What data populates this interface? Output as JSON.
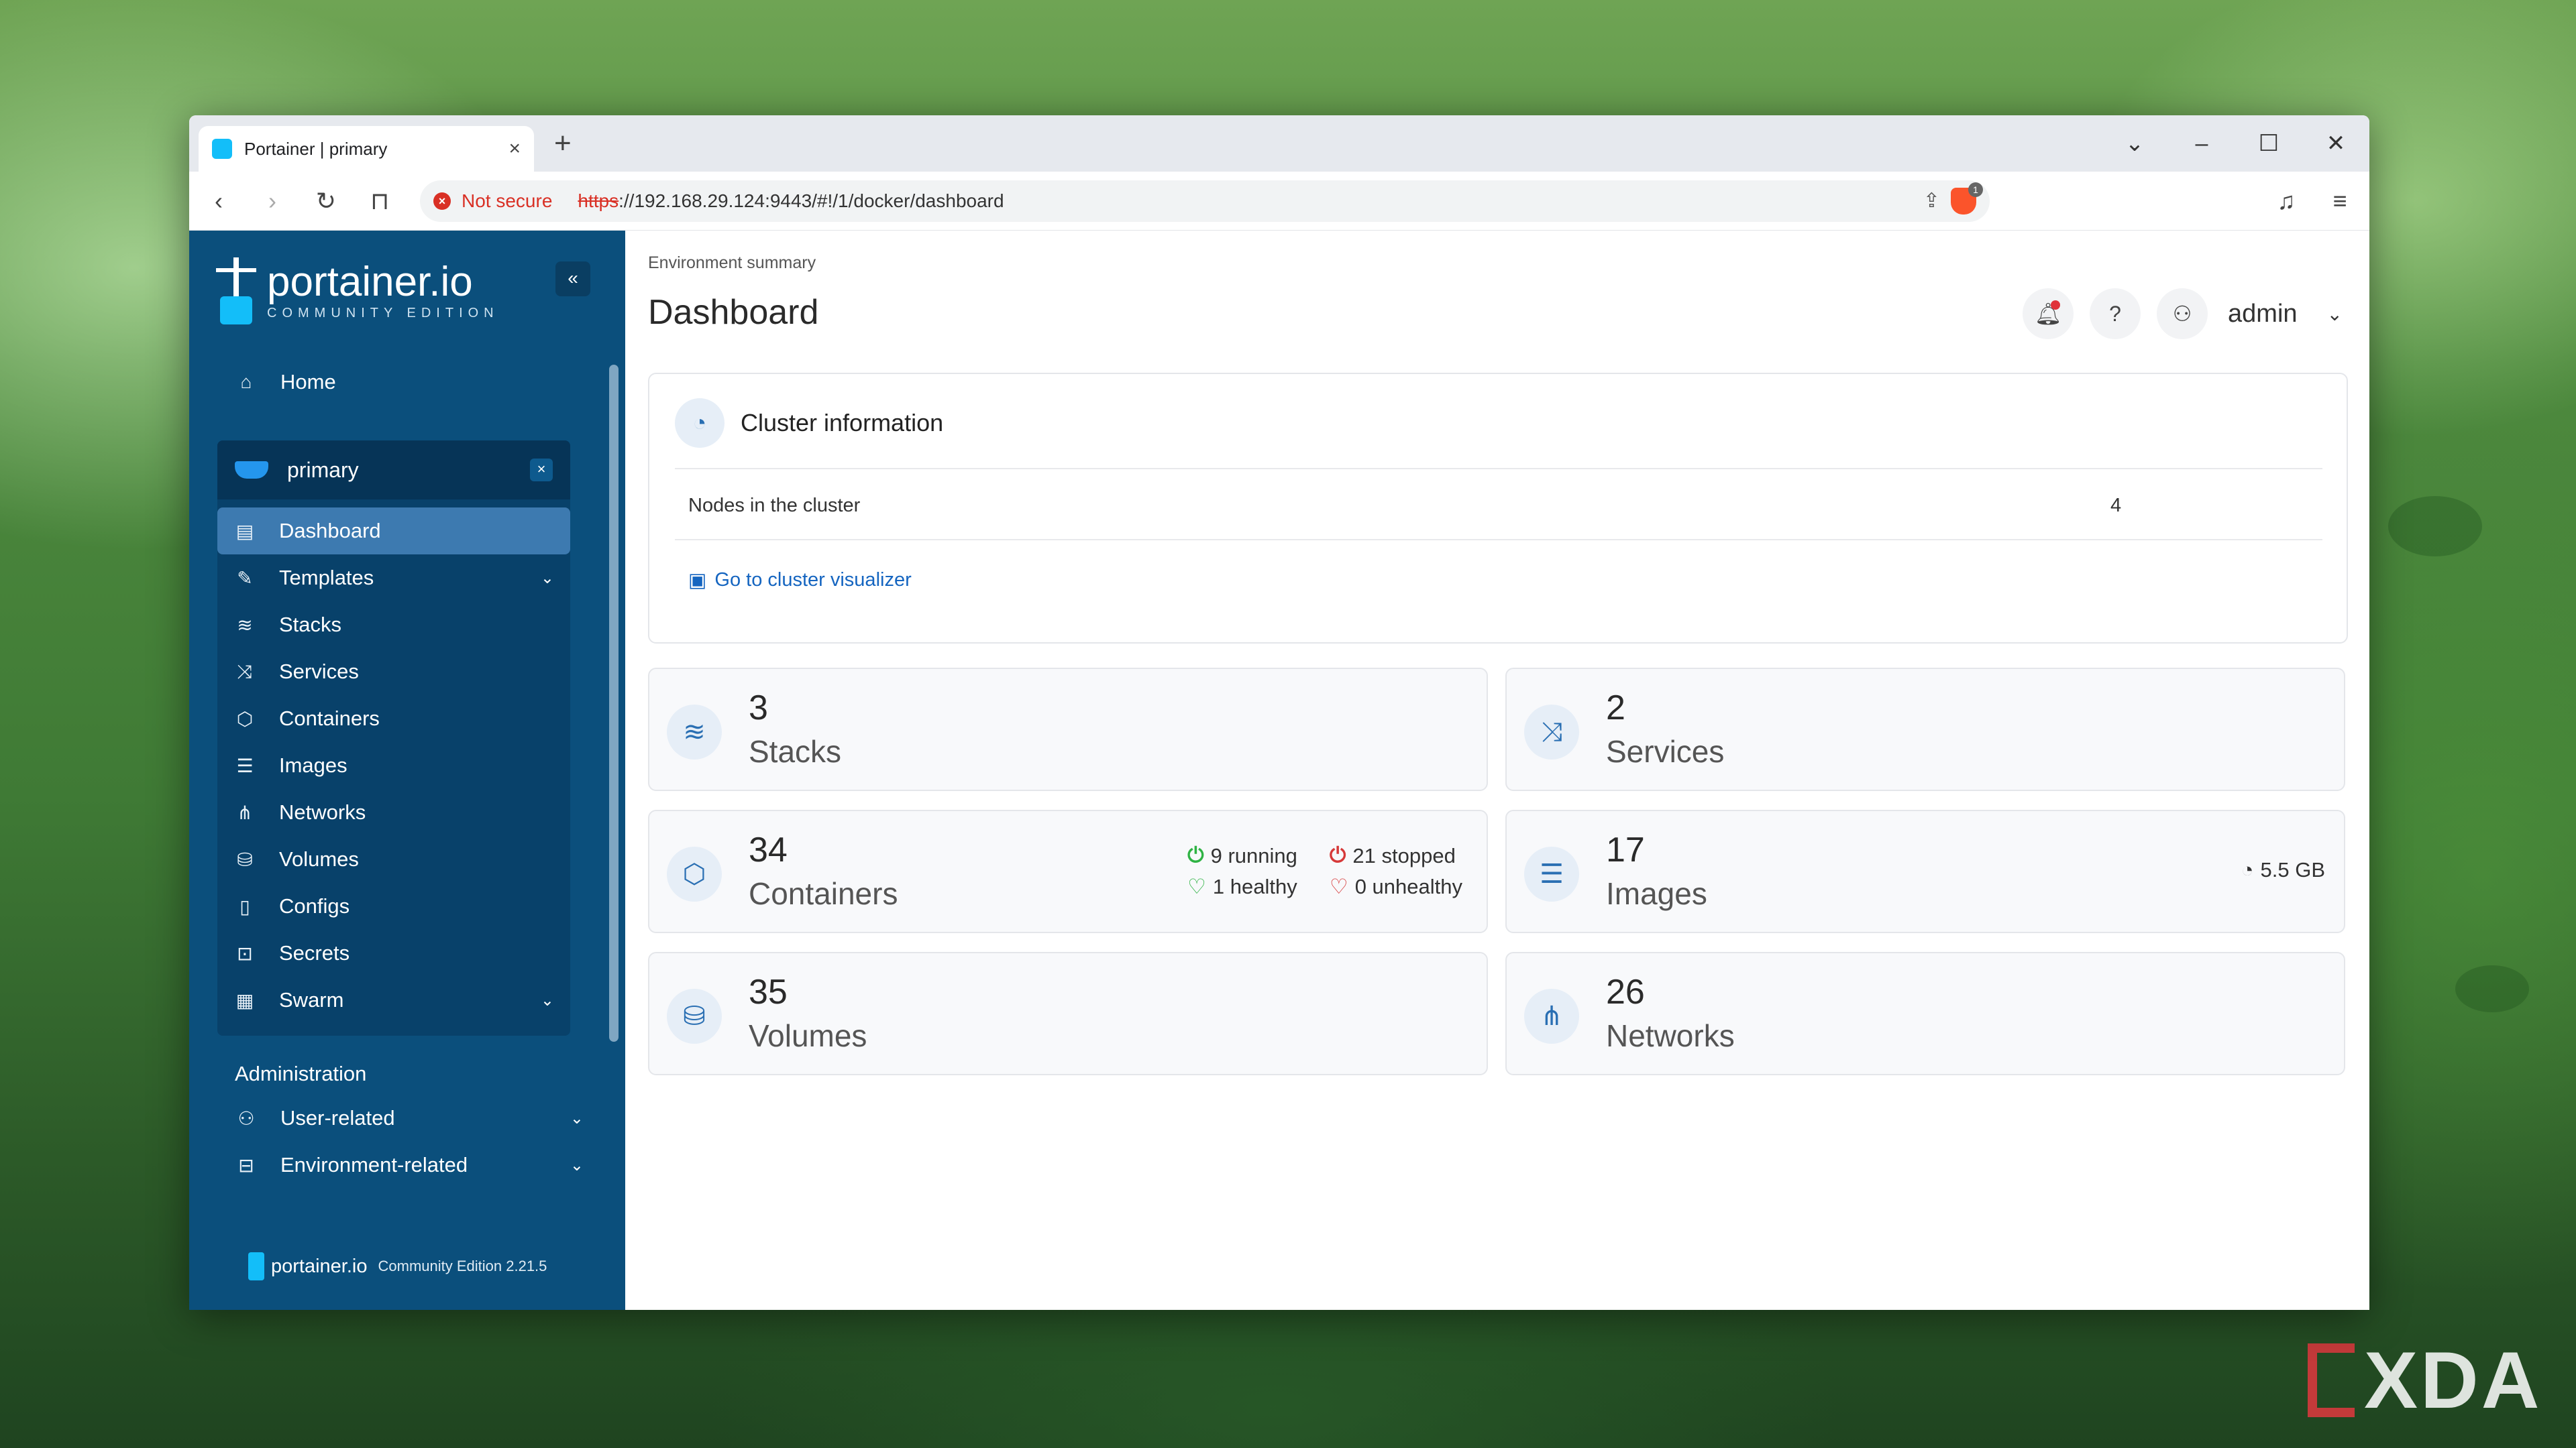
{
  "browser": {
    "tab_title": "Portainer | primary",
    "not_secure": "Not secure",
    "url_proto": "https",
    "url_rest": "://192.168.29.124:9443/#!/1/docker/dashboard",
    "brave_badge": "1"
  },
  "sidebar": {
    "logo_name": "portainer.io",
    "logo_sub": "COMMUNITY EDITION",
    "home": "Home",
    "environment": "primary",
    "items": [
      {
        "label": "Dashboard",
        "icon": "dashboard-icon"
      },
      {
        "label": "Templates",
        "icon": "edit-icon"
      },
      {
        "label": "Stacks",
        "icon": "layers-icon"
      },
      {
        "label": "Services",
        "icon": "shuffle-icon"
      },
      {
        "label": "Containers",
        "icon": "box-icon"
      },
      {
        "label": "Images",
        "icon": "list-icon"
      },
      {
        "label": "Networks",
        "icon": "network-icon"
      },
      {
        "label": "Volumes",
        "icon": "database-icon"
      },
      {
        "label": "Configs",
        "icon": "clipboard-icon"
      },
      {
        "label": "Secrets",
        "icon": "lock-icon"
      },
      {
        "label": "Swarm",
        "icon": "swarm-icon"
      }
    ],
    "admin_title": "Administration",
    "user_related": "User-related",
    "env_related": "Environment-related",
    "footer_name": "portainer.io",
    "footer_edition": "Community Edition 2.21.5"
  },
  "main": {
    "breadcrumb": "Environment summary",
    "title": "Dashboard",
    "user": "admin",
    "cluster": {
      "title": "Cluster information",
      "nodes_label": "Nodes in the cluster",
      "nodes_value": "4",
      "link": "Go to cluster visualizer"
    },
    "stats": {
      "stacks": {
        "value": "3",
        "label": "Stacks"
      },
      "services": {
        "value": "2",
        "label": "Services"
      },
      "containers": {
        "value": "34",
        "label": "Containers",
        "running": "9 running",
        "stopped": "21 stopped",
        "healthy": "1 healthy",
        "unhealthy": "0 unhealthy"
      },
      "images": {
        "value": "17",
        "label": "Images",
        "size": "5.5 GB"
      },
      "volumes": {
        "value": "35",
        "label": "Volumes"
      },
      "networks": {
        "value": "26",
        "label": "Networks"
      }
    }
  },
  "colors": {
    "sidebar": "#0b4f7c",
    "accent": "#13bef9",
    "running": "#2fb344",
    "stopped": "#d63939"
  }
}
